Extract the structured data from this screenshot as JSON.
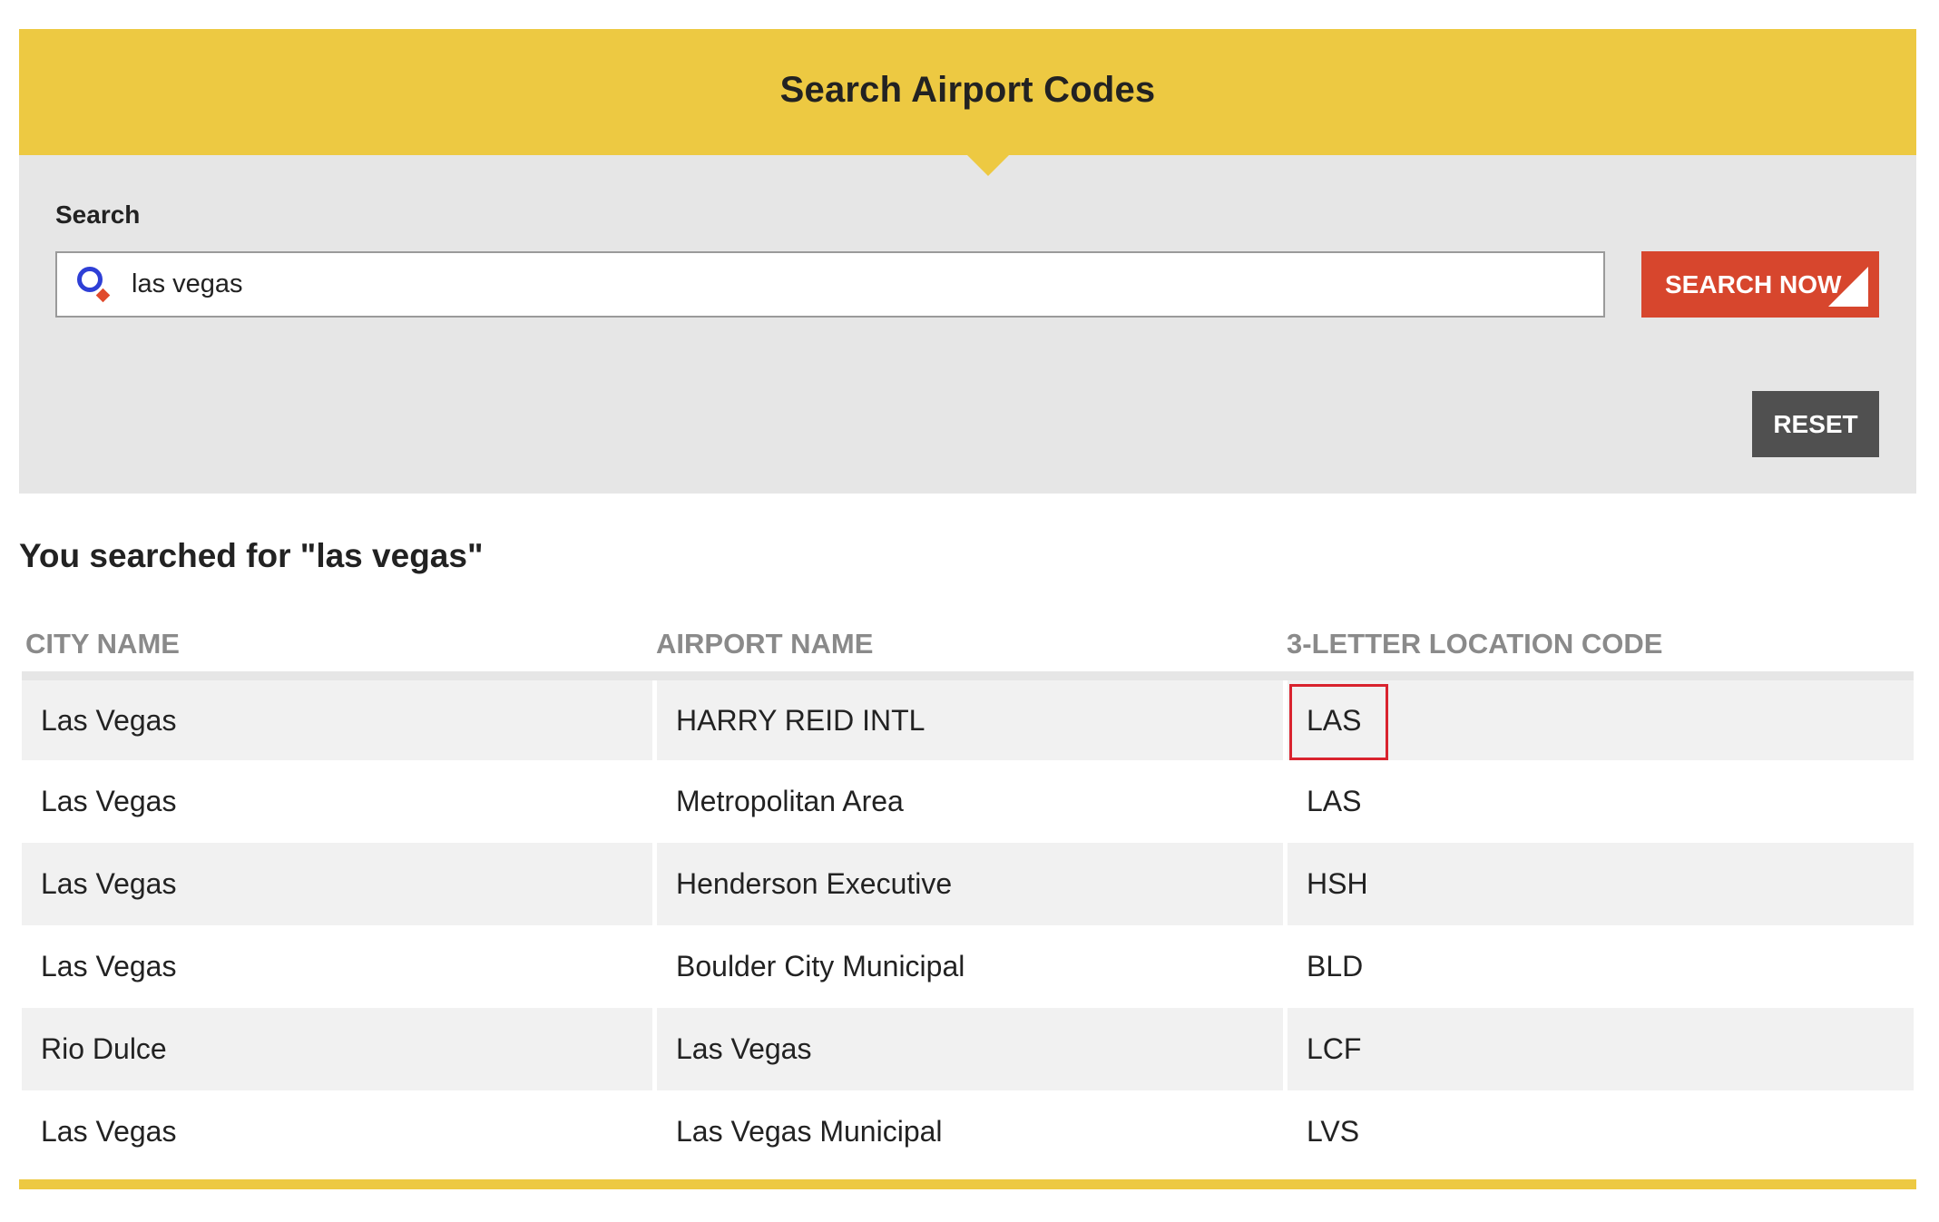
{
  "header": {
    "title": "Search Airport Codes"
  },
  "search": {
    "label": "Search",
    "value": "las vegas",
    "placeholder": "",
    "search_button": "SEARCH NOW",
    "reset_button": "RESET"
  },
  "results": {
    "heading": "You searched for \"las vegas\"",
    "columns": [
      "CITY NAME",
      "AIRPORT NAME",
      "3-LETTER LOCATION CODE"
    ],
    "rows": [
      {
        "city": "Las Vegas",
        "airport": "HARRY REID INTL",
        "code": "LAS"
      },
      {
        "city": "Las Vegas",
        "airport": "Metropolitan Area",
        "code": "LAS"
      },
      {
        "city": "Las Vegas",
        "airport": "Henderson Executive",
        "code": "HSH"
      },
      {
        "city": "Las Vegas",
        "airport": "Boulder City Municipal",
        "code": "BLD"
      },
      {
        "city": "Rio Dulce",
        "airport": "Las Vegas",
        "code": "LCF"
      },
      {
        "city": "Las Vegas",
        "airport": "Las Vegas Municipal",
        "code": "LVS"
      }
    ]
  },
  "icons": {
    "search": "search-icon",
    "button_corner": "triangle-corner-icon"
  },
  "colors": {
    "header_yellow": "#edc942",
    "panel_gray": "#e6e6e6",
    "search_button_red": "#d7462d",
    "reset_button_gray": "#505050",
    "highlight_red": "#d9232e",
    "icon_blue": "#2e3fd6"
  }
}
